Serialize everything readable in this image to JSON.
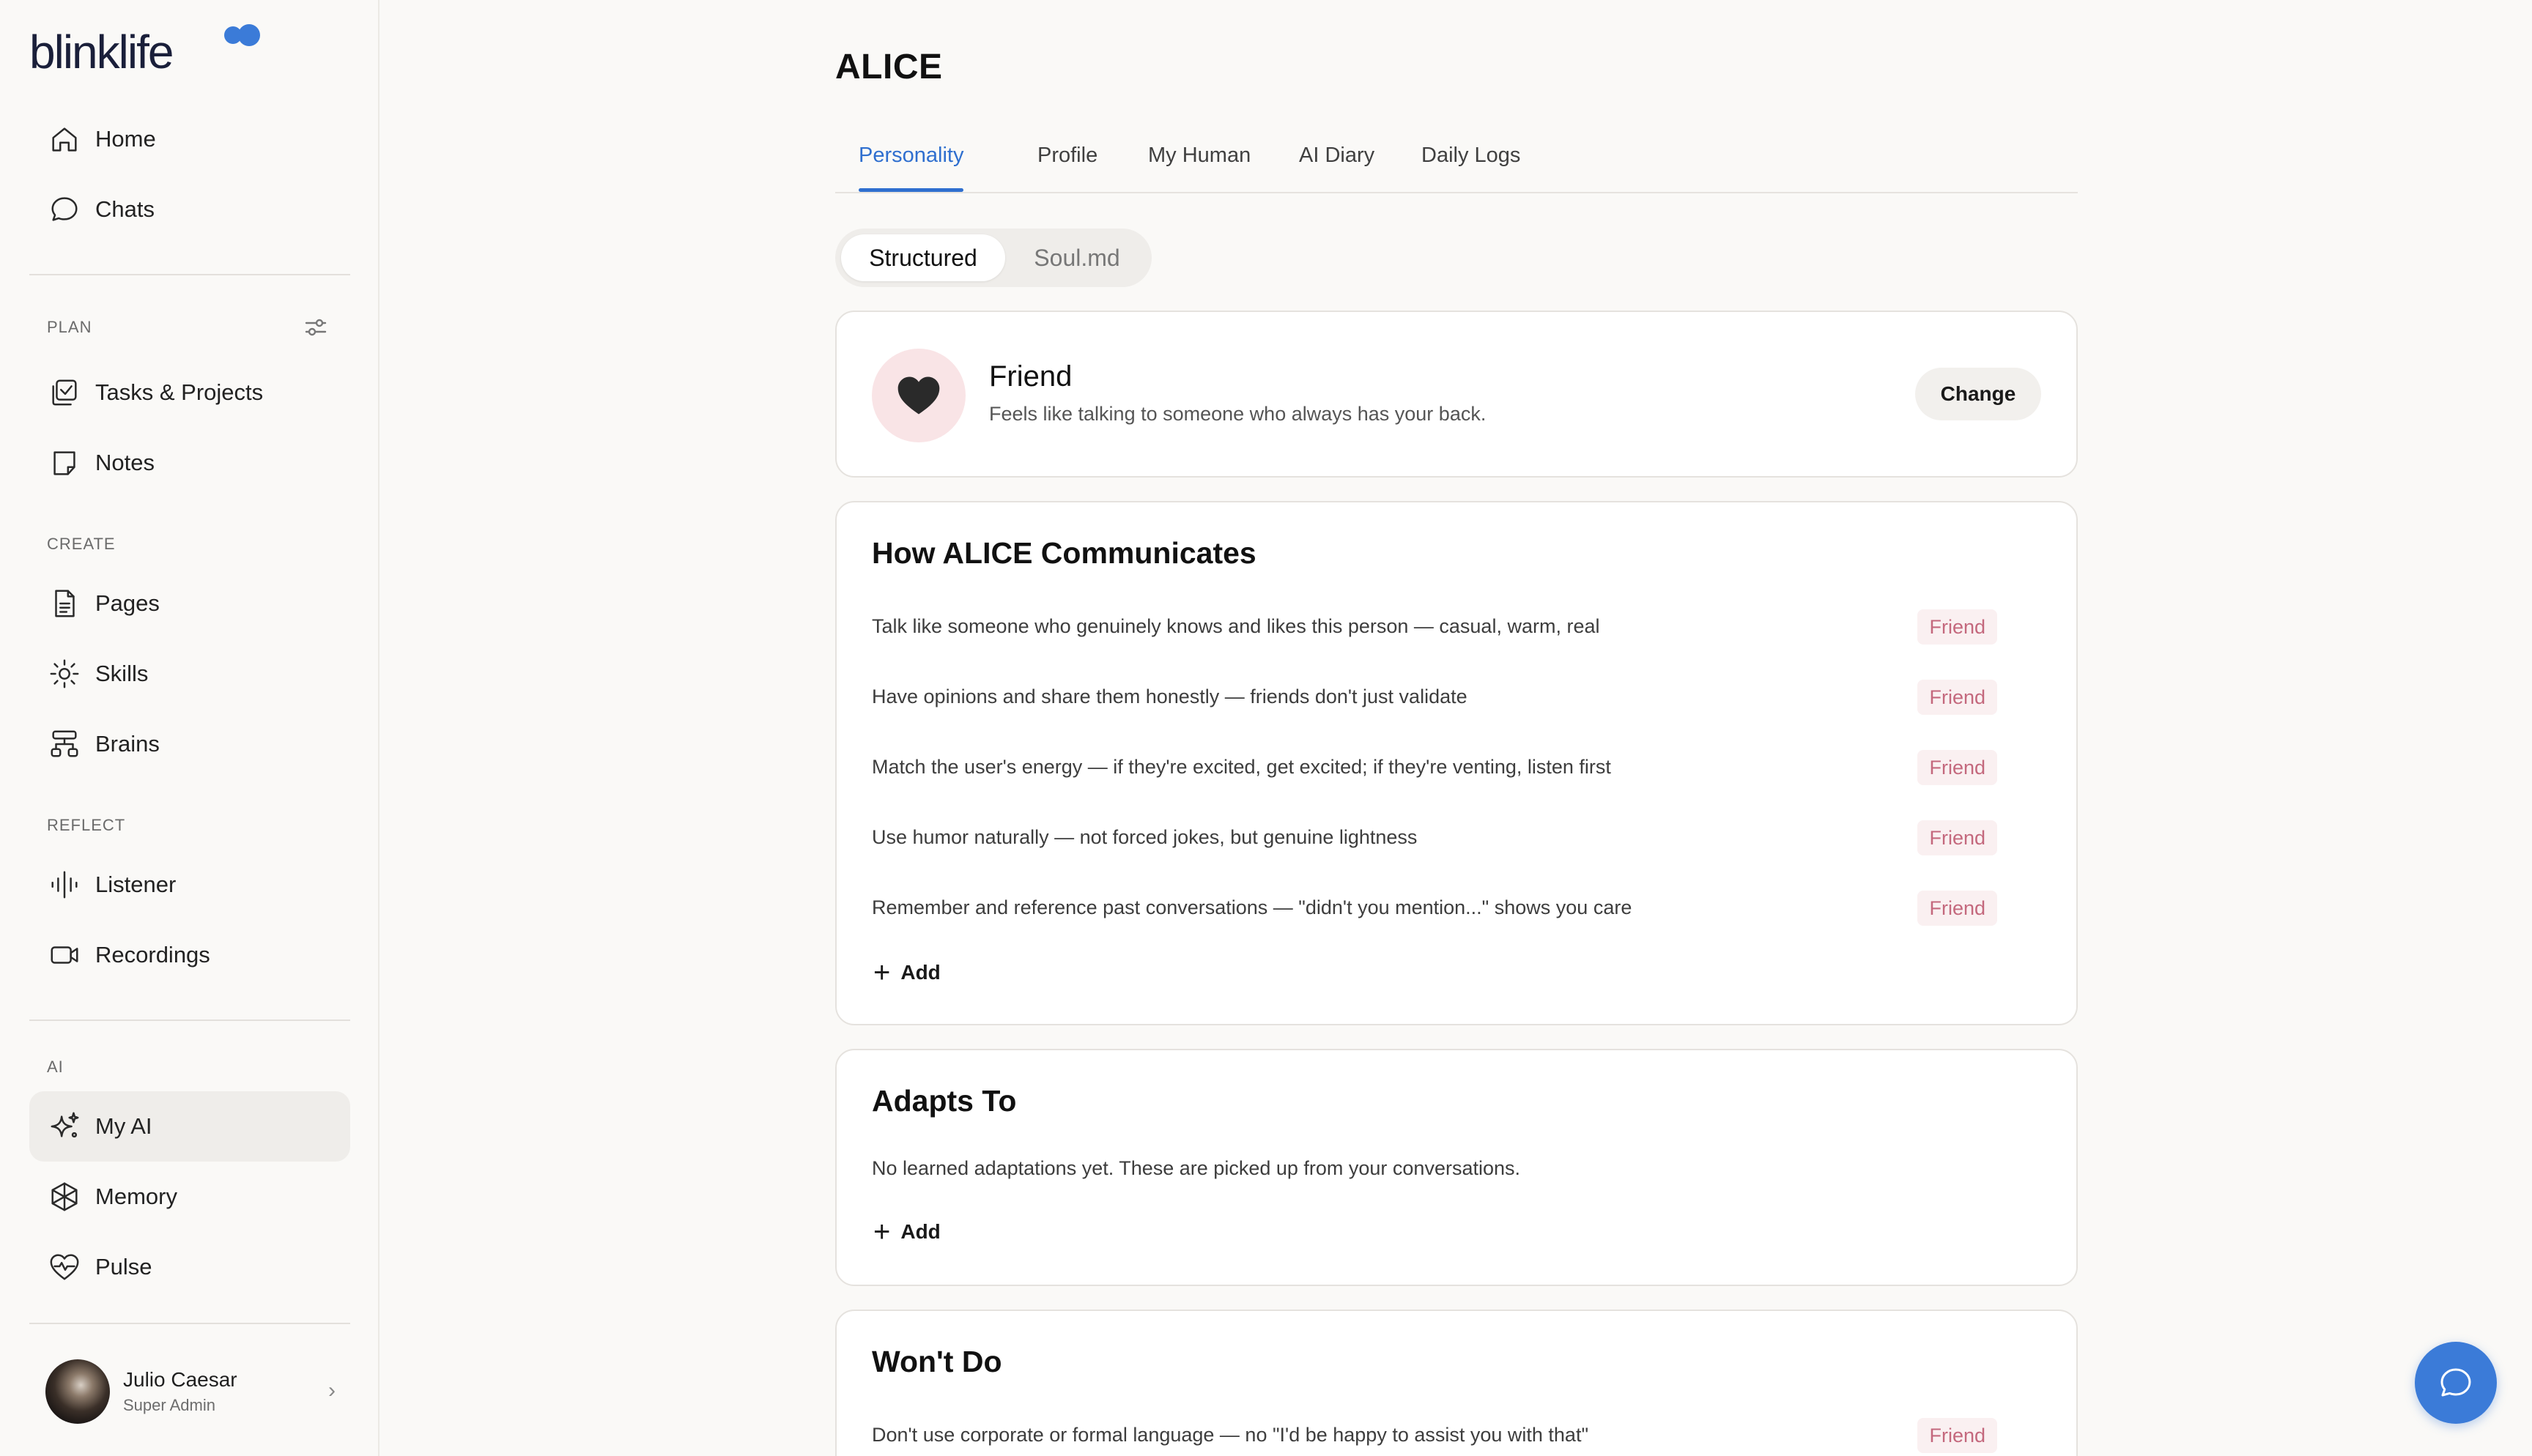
{
  "brand": {
    "logo_text": "blinklife",
    "colors": {
      "navy": "#1a1f3a",
      "blue": "#2f6fcf",
      "dot_blue": "#3b7bd8"
    }
  },
  "sidebar": {
    "top_items": [
      {
        "label": "Home",
        "icon": "home-icon"
      },
      {
        "label": "Chats",
        "icon": "chat-bubble-icon"
      }
    ],
    "plan": {
      "label": "PLAN",
      "items": [
        {
          "label": "Tasks & Projects",
          "icon": "tasks-icon"
        },
        {
          "label": "Notes",
          "icon": "note-icon"
        }
      ]
    },
    "create": {
      "label": "CREATE",
      "items": [
        {
          "label": "Pages",
          "icon": "page-icon"
        },
        {
          "label": "Skills",
          "icon": "skills-icon"
        },
        {
          "label": "Brains",
          "icon": "brains-icon"
        }
      ]
    },
    "reflect": {
      "label": "REFLECT",
      "items": [
        {
          "label": "Listener",
          "icon": "waveform-icon"
        },
        {
          "label": "Recordings",
          "icon": "video-icon"
        }
      ]
    },
    "ai": {
      "label": "AI",
      "items": [
        {
          "label": "My AI",
          "icon": "sparkle-icon",
          "active": true
        },
        {
          "label": "Memory",
          "icon": "memory-icon"
        },
        {
          "label": "Pulse",
          "icon": "heart-pulse-icon"
        }
      ]
    },
    "user": {
      "name": "Julio Caesar",
      "role": "Super Admin"
    }
  },
  "main": {
    "title": "ALICE",
    "tabs": [
      "Personality",
      "Profile",
      "My Human",
      "AI Diary",
      "Daily Logs"
    ],
    "active_tab": "Personality",
    "segment": {
      "on": "Structured",
      "off": "Soul.md"
    },
    "persona": {
      "title": "Friend",
      "subtitle": "Feels like talking to someone who always has your back.",
      "change_label": "Change"
    },
    "communicates": {
      "title": "How ALICE Communicates",
      "rules": [
        {
          "text": "Talk like someone who genuinely knows and likes this person — casual, warm, real",
          "badge": "Friend"
        },
        {
          "text": "Have opinions and share them honestly — friends don't just validate",
          "badge": "Friend"
        },
        {
          "text": "Match the user's energy — if they're excited, get excited; if they're venting, listen first",
          "badge": "Friend"
        },
        {
          "text": "Use humor naturally — not forced jokes, but genuine lightness",
          "badge": "Friend"
        },
        {
          "text": "Remember and reference past conversations — \"didn't you mention...\" shows you care",
          "badge": "Friend"
        }
      ],
      "add_label": "Add"
    },
    "adapts": {
      "title": "Adapts To",
      "empty_text": "No learned adaptations yet. These are picked up from your conversations.",
      "add_label": "Add"
    },
    "wont_do": {
      "title": "Won't Do",
      "rules": [
        {
          "text": "Don't use corporate or formal language — no \"I'd be happy to assist you with that\"",
          "badge": "Friend"
        }
      ]
    }
  }
}
